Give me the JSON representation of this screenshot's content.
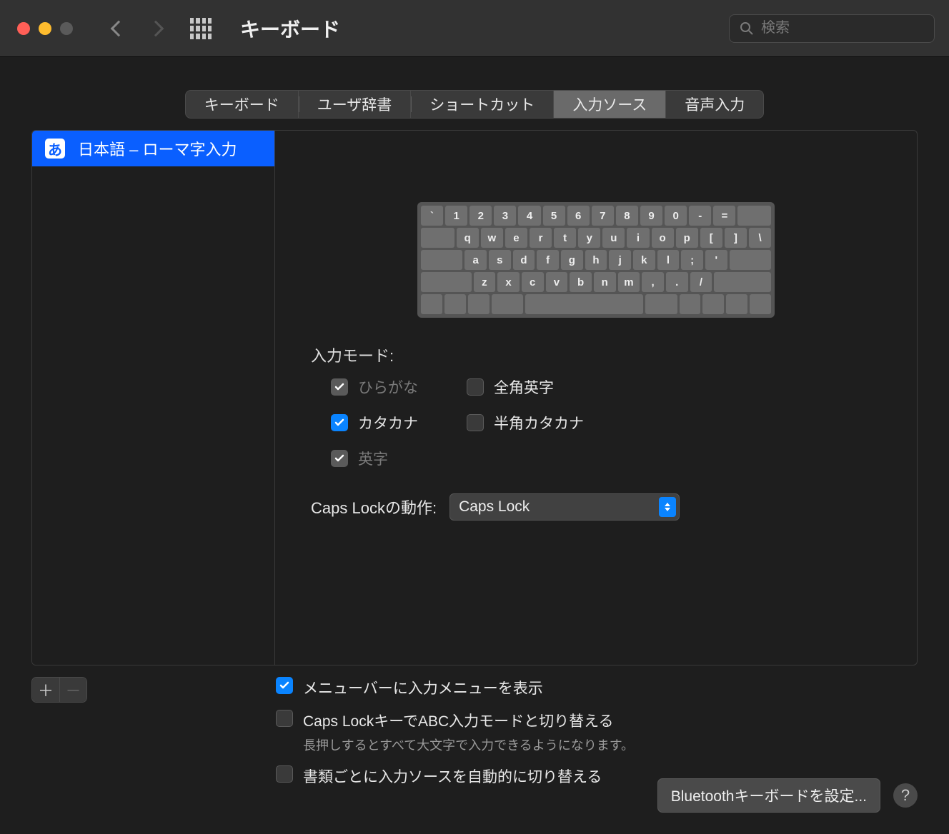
{
  "window": {
    "title": "キーボード"
  },
  "search": {
    "placeholder": "検索"
  },
  "tabs": [
    "キーボード",
    "ユーザ辞書",
    "ショートカット",
    "入力ソース",
    "音声入力"
  ],
  "active_tab_index": 3,
  "sources": [
    {
      "icon_text": "あ",
      "label": "日本語 – ローマ字入力",
      "selected": true
    }
  ],
  "keyboard_rows": [
    [
      "`",
      "1",
      "2",
      "3",
      "4",
      "5",
      "6",
      "7",
      "8",
      "9",
      "0",
      "-",
      "="
    ],
    [
      "q",
      "w",
      "e",
      "r",
      "t",
      "y",
      "u",
      "i",
      "o",
      "p",
      "[",
      "]",
      "\\"
    ],
    [
      "a",
      "s",
      "d",
      "f",
      "g",
      "h",
      "j",
      "k",
      "l",
      ";",
      "'"
    ],
    [
      "z",
      "x",
      "c",
      "v",
      "b",
      "n",
      "m",
      ",",
      ".",
      "/"
    ]
  ],
  "input_modes_label": "入力モード:",
  "modes": [
    {
      "label": "ひらがな",
      "checked": true,
      "disabled": true
    },
    {
      "label": "全角英字",
      "checked": false,
      "disabled": false
    },
    {
      "label": "カタカナ",
      "checked": true,
      "disabled": false
    },
    {
      "label": "半角カタカナ",
      "checked": false,
      "disabled": false
    },
    {
      "label": "英字",
      "checked": true,
      "disabled": true
    }
  ],
  "caps_lock": {
    "label": "Caps Lockの動作:",
    "value": "Caps Lock"
  },
  "options": [
    {
      "label": "メニューバーに入力メニューを表示",
      "checked": true
    },
    {
      "label": "Caps LockキーでABC入力モードと切り替える",
      "checked": false,
      "sub": "長押しするとすべて大文字で入力できるようになります。"
    },
    {
      "label": "書類ごとに入力ソースを自動的に切り替える",
      "checked": false
    }
  ],
  "footer": {
    "bluetooth_button": "Bluetoothキーボードを設定..."
  }
}
